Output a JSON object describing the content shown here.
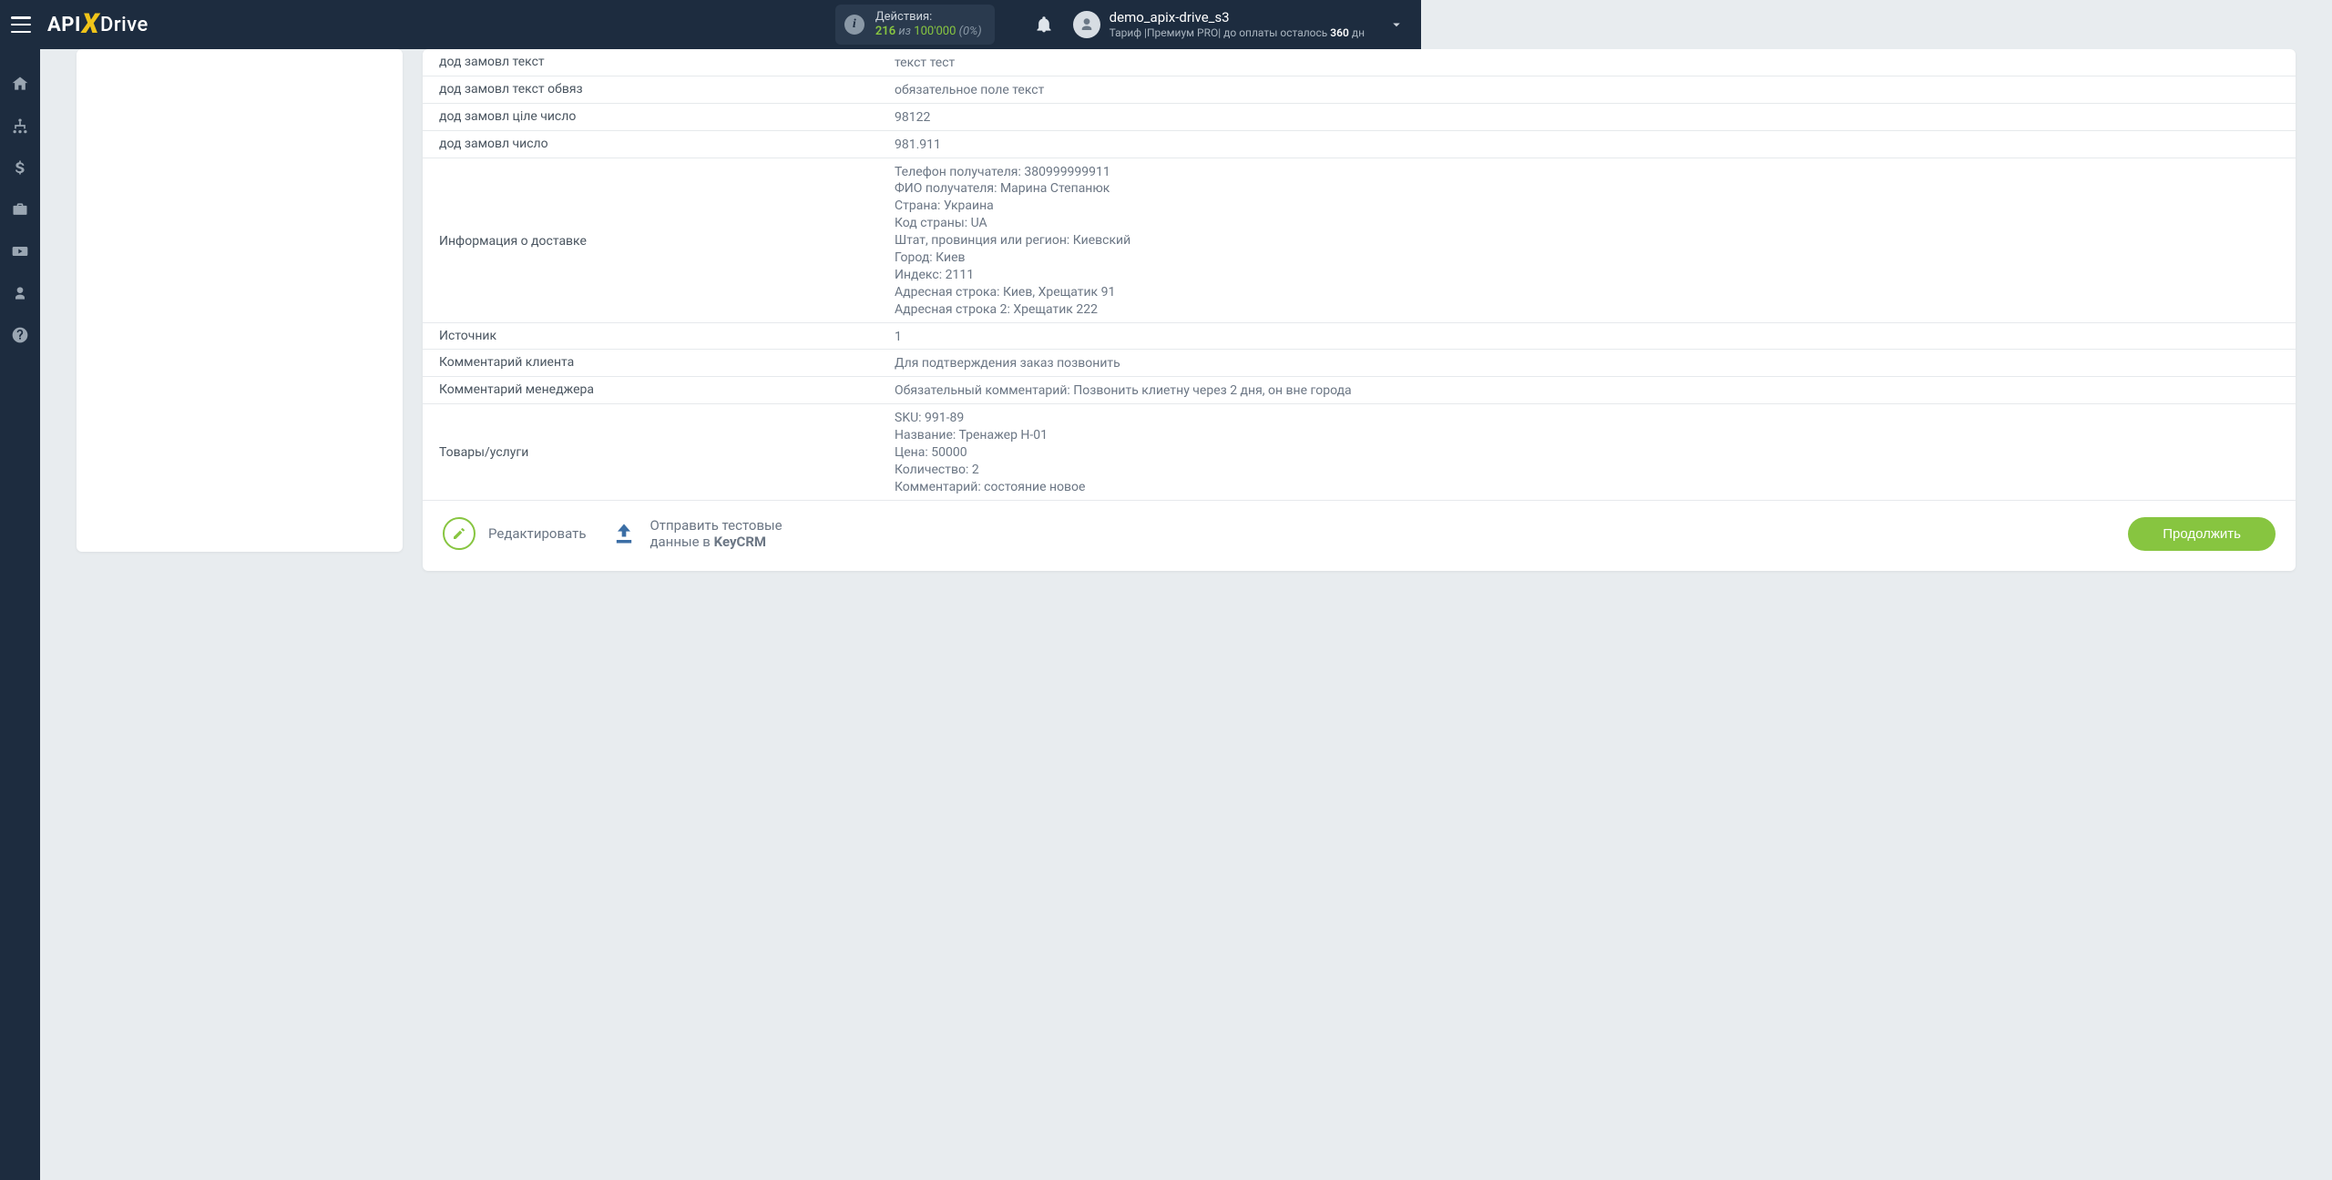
{
  "header": {
    "logo_api": "API",
    "logo_drive": "Drive",
    "actions_label": "Действия:",
    "actions_count": "216",
    "actions_of": "из",
    "actions_limit": "100'000",
    "actions_pct": "(0%)",
    "username": "demo_apix-drive_s3",
    "tariff_prefix": "Тариф |Премиум PRO| до оплаты осталось ",
    "tariff_days": "360",
    "tariff_suffix": " дн"
  },
  "rows": [
    {
      "key": "дод замовл текст",
      "val": "текст тест"
    },
    {
      "key": "дод замовл текст обвяз",
      "val": "обязательное поле текст"
    },
    {
      "key": "дод замовл ціле число",
      "val": "98122"
    },
    {
      "key": "дод замовл число",
      "val": "981.911"
    },
    {
      "key": "Информация о доставке",
      "val": "Телефон получателя: 380999999911\nФИО получателя: Марина Степанюк\nСтрана: Украина\nКод страны: UA\nШтат, провинция или регион: Киевский\nГород: Киев\nИндекс: 2111\nАдресная строка: Киев, Хрещатик 91\nАдресная строка 2: Хрещатик 222"
    },
    {
      "key": "Источник",
      "val": "1"
    },
    {
      "key": "Комментарий клиента",
      "val": "Для подтверждения заказ позвонить"
    },
    {
      "key": "Комментарий менеджера",
      "val": "Обязательный комментарий: Позвонить клиетну через 2 дня, он вне города"
    },
    {
      "key": "Товары/услуги",
      "val": "SKU: 991-89\nНазвание: Тренажер H-01\nЦена: 50000\nКоличество: 2\nКомментарий: состояние новое"
    }
  ],
  "actions": {
    "edit": "Редактировать",
    "send_line1": "Отправить тестовые",
    "send_line2_prefix": "данные в ",
    "send_brand": "KeyCRM",
    "continue": "Продолжить"
  }
}
